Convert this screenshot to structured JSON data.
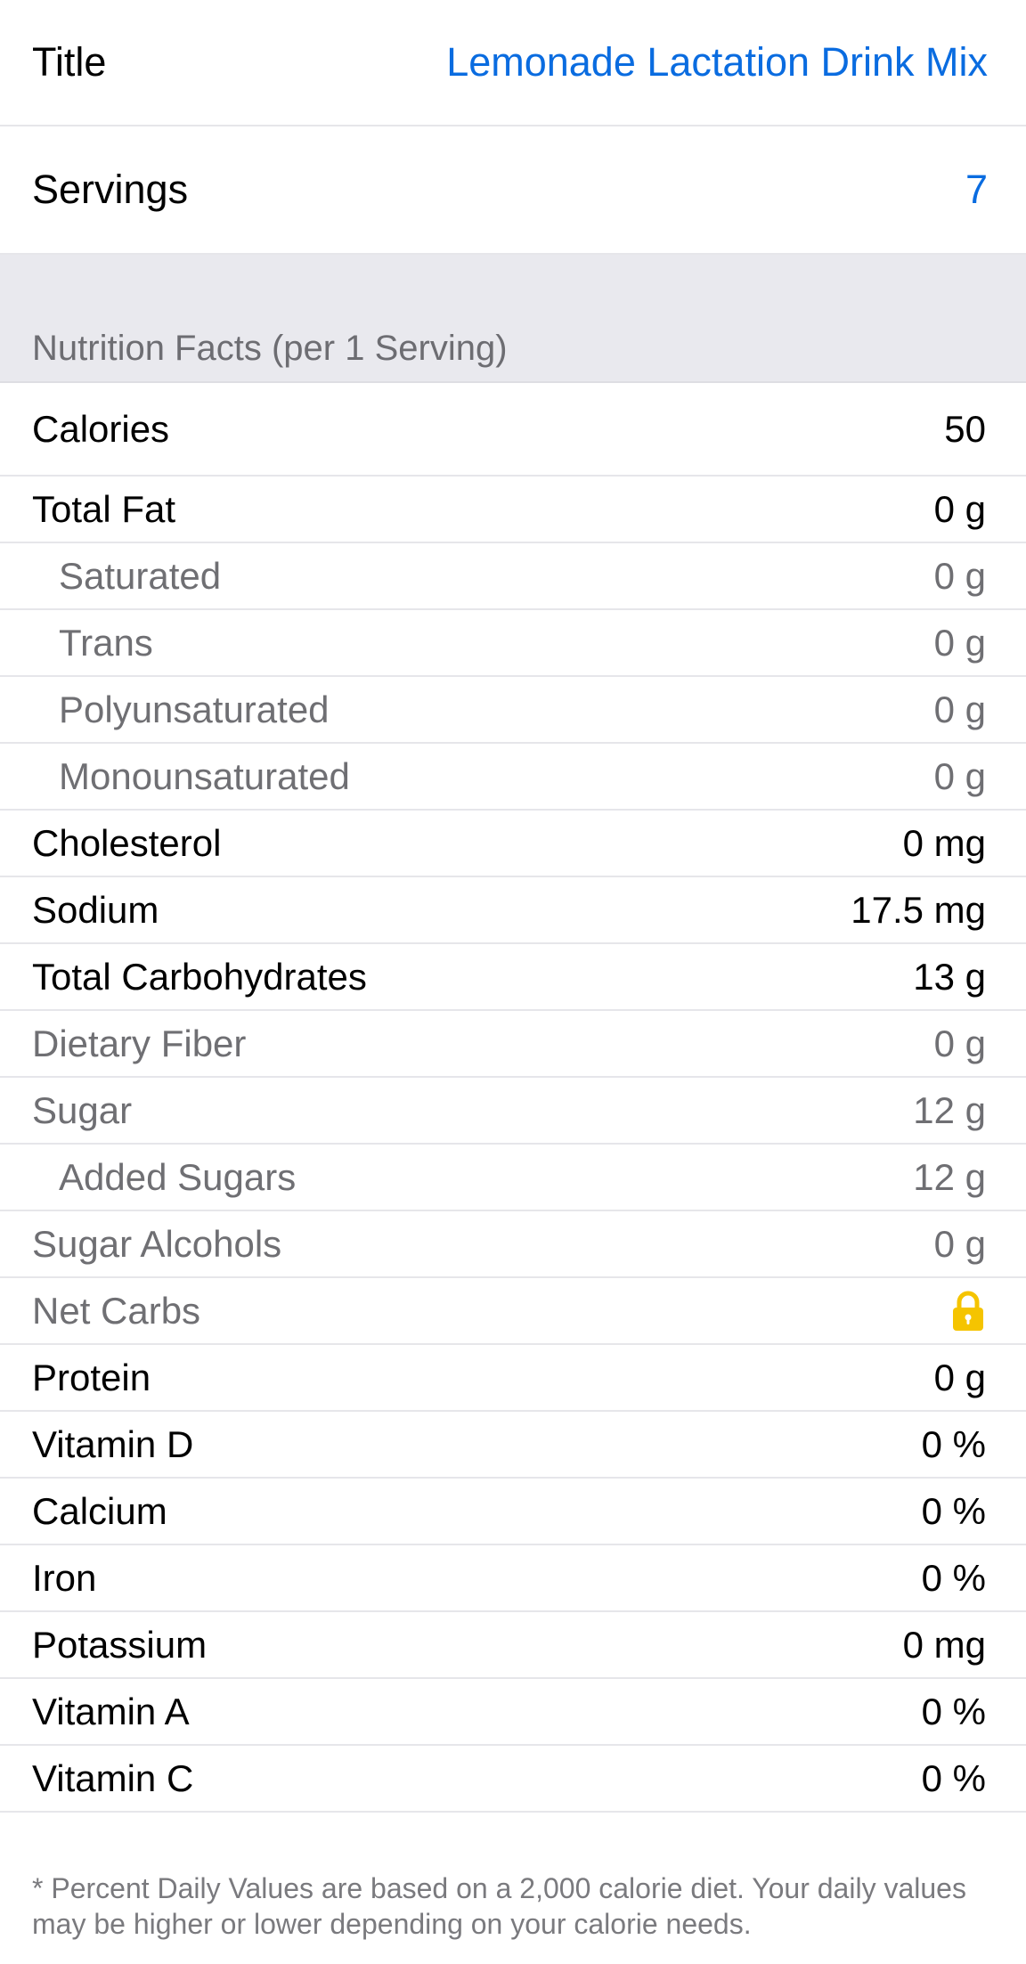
{
  "header": {
    "title_label": "Title",
    "title_value": "Lemonade Lactation Drink Mix",
    "servings_label": "Servings",
    "servings_value": "7"
  },
  "section": {
    "title": "Nutrition Facts (per 1 Serving)"
  },
  "nutrients": [
    {
      "label": "Calories",
      "value": "50"
    },
    {
      "label": "Total Fat",
      "value": "0 g"
    },
    {
      "label": "Saturated",
      "value": "0 g"
    },
    {
      "label": "Trans",
      "value": "0 g"
    },
    {
      "label": "Polyunsaturated",
      "value": "0 g"
    },
    {
      "label": "Monounsaturated",
      "value": "0 g"
    },
    {
      "label": "Cholesterol",
      "value": "0 mg"
    },
    {
      "label": "Sodium",
      "value": "17.5 mg"
    },
    {
      "label": "Total Carbohydrates",
      "value": "13 g"
    },
    {
      "label": "Dietary Fiber",
      "value": "0 g"
    },
    {
      "label": "Sugar",
      "value": "12 g"
    },
    {
      "label": "Added Sugars",
      "value": "12 g"
    },
    {
      "label": "Sugar Alcohols",
      "value": "0 g"
    },
    {
      "label": "Net Carbs",
      "icon": "lock-icon"
    },
    {
      "label": "Protein",
      "value": "0 g"
    },
    {
      "label": "Vitamin D",
      "value": "0 %"
    },
    {
      "label": "Calcium",
      "value": "0 %"
    },
    {
      "label": "Iron",
      "value": "0 %"
    },
    {
      "label": "Potassium",
      "value": "0 mg"
    },
    {
      "label": "Vitamin A",
      "value": "0 %"
    },
    {
      "label": "Vitamin C",
      "value": "0 %"
    }
  ],
  "footnote": "* Percent Daily Values are based on a 2,000 calorie diet.  Your daily values may be higher or lower depending on your calorie needs.",
  "colors": {
    "accent": "#0a6ce0",
    "lock": "#f5c400",
    "section_bg": "#e9e9ee"
  }
}
